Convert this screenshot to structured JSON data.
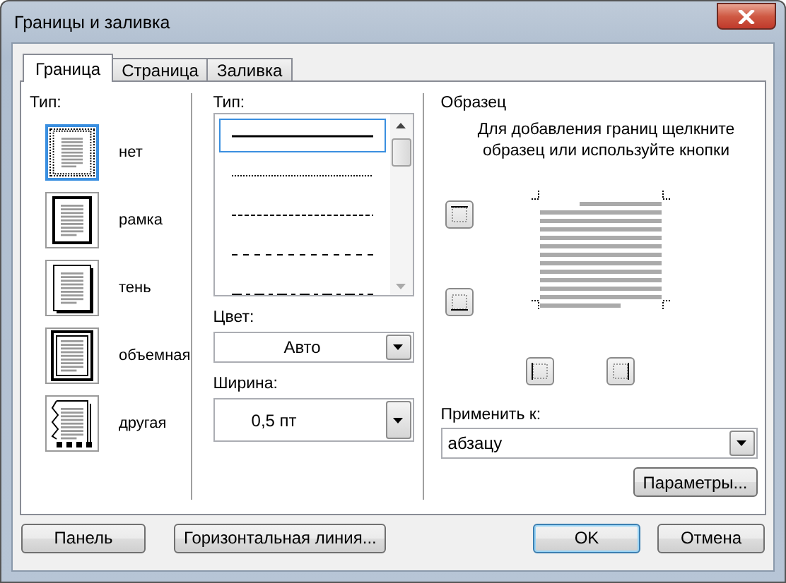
{
  "window": {
    "title": "Границы и заливка"
  },
  "tabs": [
    {
      "label": "Граница",
      "selected": true
    },
    {
      "label": "Страница",
      "selected": false
    },
    {
      "label": "Заливка",
      "selected": false
    }
  ],
  "type_panel": {
    "label": "Тип:",
    "options": [
      {
        "label": "нет",
        "kind": "none",
        "selected": true
      },
      {
        "label": "рамка",
        "kind": "box",
        "selected": false
      },
      {
        "label": "тень",
        "kind": "shadow",
        "selected": false
      },
      {
        "label": "объемная",
        "kind": "threed",
        "selected": false
      },
      {
        "label": "другая",
        "kind": "custom",
        "selected": false
      }
    ]
  },
  "line_style": {
    "label": "Тип:",
    "styles": [
      {
        "kind": "solid",
        "selected": true
      },
      {
        "kind": "dotted",
        "selected": false
      },
      {
        "kind": "dashed",
        "selected": false
      },
      {
        "kind": "longdash",
        "selected": false
      },
      {
        "kind": "dashdot",
        "selected": false
      }
    ]
  },
  "color": {
    "label": "Цвет:",
    "value": "Авто"
  },
  "width": {
    "label": "Ширина:",
    "value": "0,5 пт"
  },
  "preview": {
    "title": "Образец",
    "hint": "Для добавления границ щелкните образец или используйте кнопки",
    "buttons": [
      {
        "kind": "top"
      },
      {
        "kind": "bottom"
      },
      {
        "kind": "left"
      },
      {
        "kind": "right"
      }
    ]
  },
  "apply_to": {
    "label": "Применить к:",
    "value": "абзацу"
  },
  "options_button": "Параметры...",
  "buttons": [
    {
      "label": "Панель",
      "kind": "left"
    },
    {
      "label": "Горизонтальная линия...",
      "kind": "left"
    },
    {
      "label": "OK",
      "kind": "default"
    },
    {
      "label": "Отмена",
      "kind": "right"
    }
  ]
}
